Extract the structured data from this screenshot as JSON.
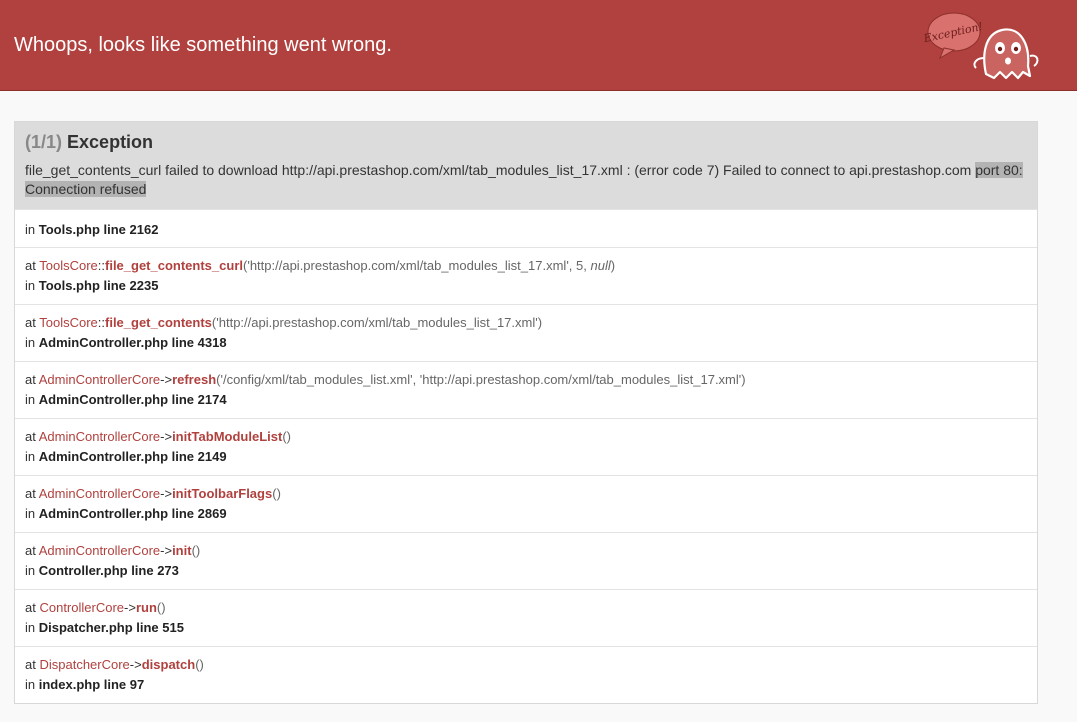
{
  "header": {
    "title": "Whoops, looks like something went wrong.",
    "logo_text": "Exception!",
    "logo_icon": "ghost-icon",
    "brand_color": "#b0413e"
  },
  "exception": {
    "count": "(1/1)",
    "type": "Exception",
    "message_main": "file_get_contents_curl failed to download http://api.prestashop.com/xml/tab_modules_list_17.xml : (error code 7) Failed to connect to api.prestashop.com ",
    "message_selected_1": "port 80:",
    "message_selected_2": "Connection refused"
  },
  "first_location": {
    "prefix": "in",
    "file": "Tools.php line 2162"
  },
  "trace": [
    {
      "at": "at",
      "class": "ToolsCore",
      "sep": "::",
      "function": "file_get_contents_curl",
      "open": "(",
      "args": "'http://api.prestashop.com/xml/tab_modules_list_17.xml', 5, ",
      "args_italic": "null",
      "close": ")",
      "in": "in",
      "location": "Tools.php line 2235"
    },
    {
      "at": "at",
      "class": "ToolsCore",
      "sep": "::",
      "function": "file_get_contents",
      "open": "(",
      "args": "'http://api.prestashop.com/xml/tab_modules_list_17.xml'",
      "args_italic": "",
      "close": ")",
      "in": "in",
      "location": "AdminController.php line 4318"
    },
    {
      "at": "at",
      "class": "AdminControllerCore",
      "sep": "->",
      "function": "refresh",
      "open": "(",
      "args": "'/config/xml/tab_modules_list.xml', 'http://api.prestashop.com/xml/tab_modules_list_17.xml'",
      "args_italic": "",
      "close": ")",
      "in": "in",
      "location": "AdminController.php line 2174"
    },
    {
      "at": "at",
      "class": "AdminControllerCore",
      "sep": "->",
      "function": "initTabModuleList",
      "open": "(",
      "args": "",
      "args_italic": "",
      "close": ")",
      "in": "in",
      "location": "AdminController.php line 2149"
    },
    {
      "at": "at",
      "class": "AdminControllerCore",
      "sep": "->",
      "function": "initToolbarFlags",
      "open": "(",
      "args": "",
      "args_italic": "",
      "close": ")",
      "in": "in",
      "location": "AdminController.php line 2869"
    },
    {
      "at": "at",
      "class": "AdminControllerCore",
      "sep": "->",
      "function": "init",
      "open": "(",
      "args": "",
      "args_italic": "",
      "close": ")",
      "in": "in",
      "location": "Controller.php line 273"
    },
    {
      "at": "at",
      "class": "ControllerCore",
      "sep": "->",
      "function": "run",
      "open": "(",
      "args": "",
      "args_italic": "",
      "close": ")",
      "in": "in",
      "location": "Dispatcher.php line 515"
    },
    {
      "at": "at",
      "class": "DispatcherCore",
      "sep": "->",
      "function": "dispatch",
      "open": "(",
      "args": "",
      "args_italic": "",
      "close": ")",
      "in": "in",
      "location": "index.php line 97"
    }
  ]
}
